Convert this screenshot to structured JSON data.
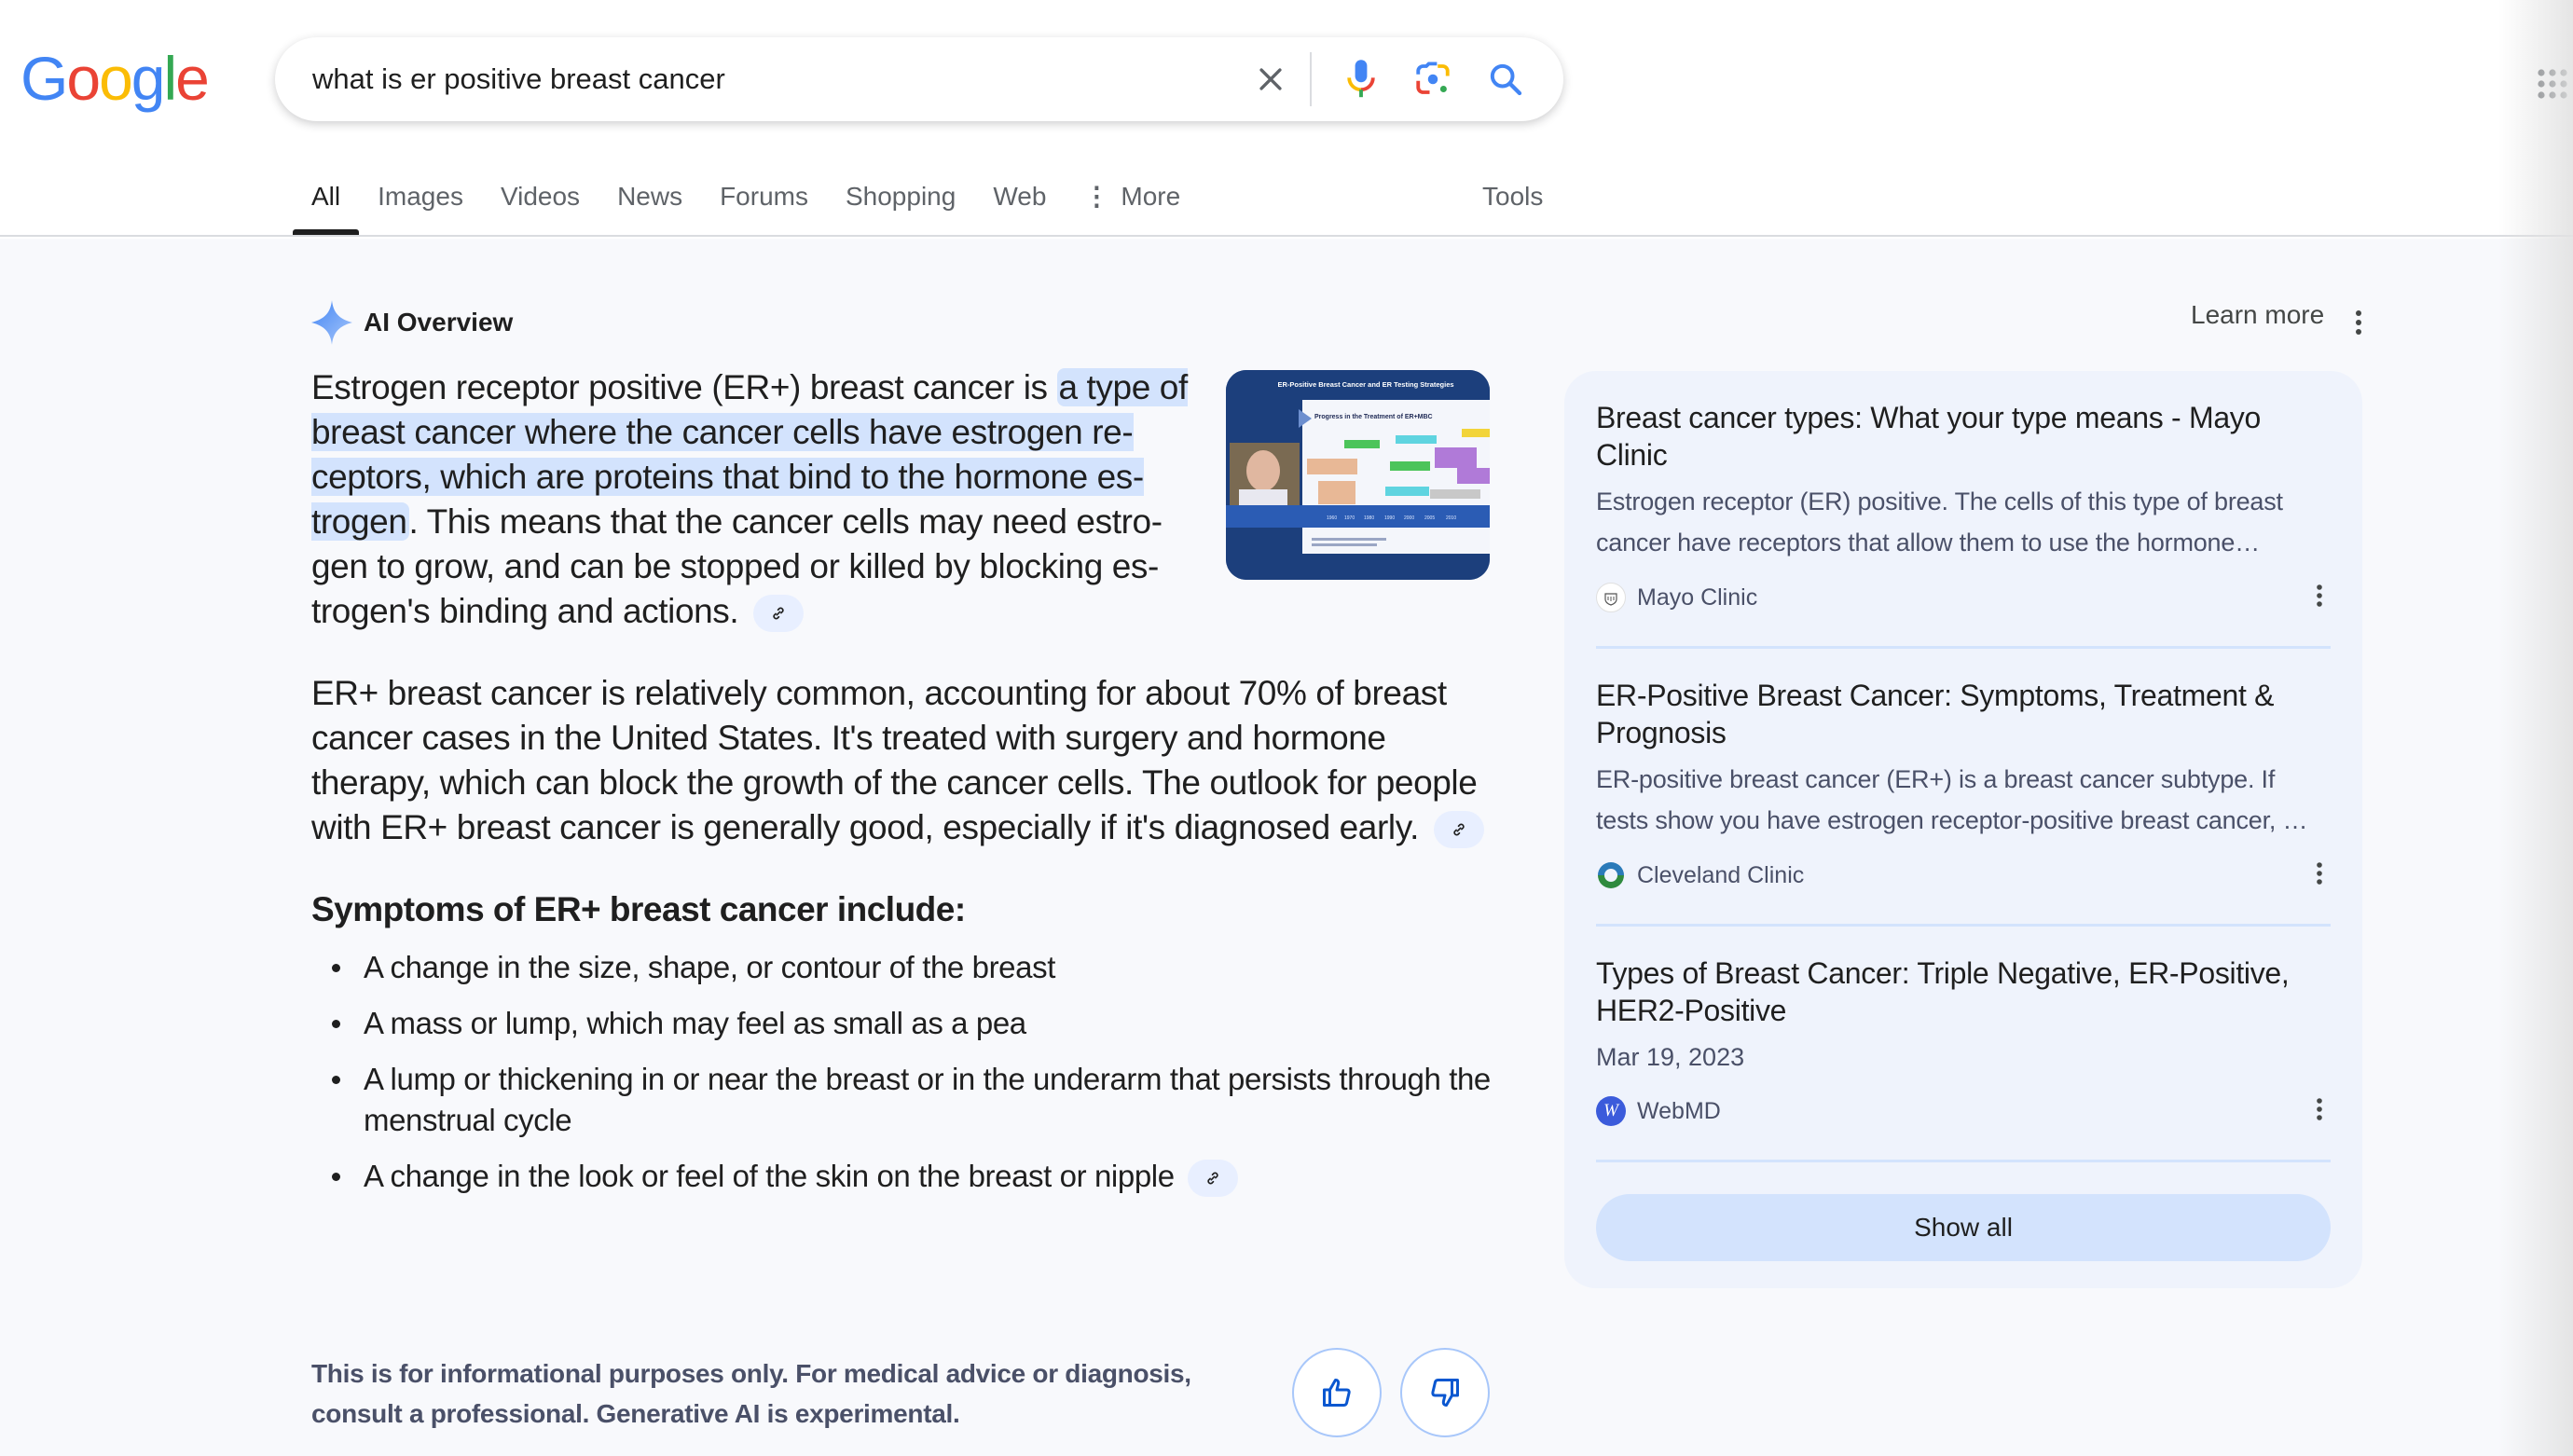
{
  "header": {
    "logo_letters": [
      {
        "ch": "G",
        "color": "#4285f4"
      },
      {
        "ch": "o",
        "color": "#ea4335"
      },
      {
        "ch": "o",
        "color": "#fbbc05"
      },
      {
        "ch": "g",
        "color": "#4285f4"
      },
      {
        "ch": "l",
        "color": "#34a853"
      },
      {
        "ch": "e",
        "color": "#ea4335"
      }
    ],
    "search_query": "what is er positive breast cancer",
    "icons": [
      "close-icon",
      "microphone-icon",
      "google-lens-icon",
      "search-icon",
      "apps-grid-icon"
    ]
  },
  "tabs": [
    {
      "label": "All",
      "active": true
    },
    {
      "label": "Images"
    },
    {
      "label": "Videos"
    },
    {
      "label": "News"
    },
    {
      "label": "Forums"
    },
    {
      "label": "Shopping"
    },
    {
      "label": "Web"
    },
    {
      "label": "More",
      "icon": "more-vert-icon"
    }
  ],
  "tools_label": "Tools",
  "ai_overview": {
    "title": "AI Overview",
    "learn_more": "Learn more",
    "para1_pre": "Estrogen receptor positive (ER+) breast cancer is ",
    "para1_highlight": "a type of breast cancer where the cancer cells have estrogen re­ceptors, which are proteins that bind to the hormone es­trogen",
    "para1_post": ". This means that the cancer cells may need estro­gen to grow, and can be stopped or killed by blocking es­trogen's binding and actions.",
    "para2": "ER+ breast cancer is relatively common, accounting for about 70% of breast cancer cases in the United States. It's treated with surgery and hormone therapy, which can block the growth of the cancer cells. The outlook for people with ER+ breast cancer is generally good, especially if it's diagnosed early.",
    "symptoms_heading": "Symptoms of ER+ breast cancer include:",
    "symptoms": [
      "A change in the size, shape, or contour of the breast",
      "A mass or lump, which may feel as small as a pea",
      "A lump or thickening in or near the breast or in the underarm that persists through the menstrual cycle",
      "A change in the look or feel of the skin on the breast or nipple"
    ],
    "thumbnail": {
      "slide_title": "ER-Positive Breast Cancer and ER Testing Strategies",
      "chart_title": "Progress in the Treatment of ER+MBC"
    },
    "disclaimer": "This is for informational purposes only. For medical advice or diagnosis, consult a professional. Generative AI is experimental.",
    "feedback": [
      "thumbs-up-icon",
      "thumbs-down-icon"
    ]
  },
  "sources": [
    {
      "title": "Breast cancer types: What your type means - Mayo Clinic",
      "snippet": "Estrogen receptor (ER) positive. The cells of this type of breast cancer have receptors that allow them to use the hormone…",
      "site": "Mayo Clinic"
    },
    {
      "title": "ER-Positive Breast Cancer: Symptoms, Treatment & Prognosis",
      "snippet": "ER-positive breast cancer (ER+) is a breast cancer subtype. If tests show you have estrogen receptor-positive breast cancer, …",
      "site": "Cleveland Clinic"
    },
    {
      "title": "Types of Breast Cancer: Triple Negative, ER-Positive, HER2-Positive",
      "date": "Mar 19, 2023",
      "site": "WebMD"
    }
  ],
  "show_all_label": "Show all",
  "colors": {
    "accent_blue": "#4285f4",
    "highlight": "#d3e3fd",
    "panel_bg": "#eff3fc",
    "page_bg": "#f8f9fc"
  }
}
